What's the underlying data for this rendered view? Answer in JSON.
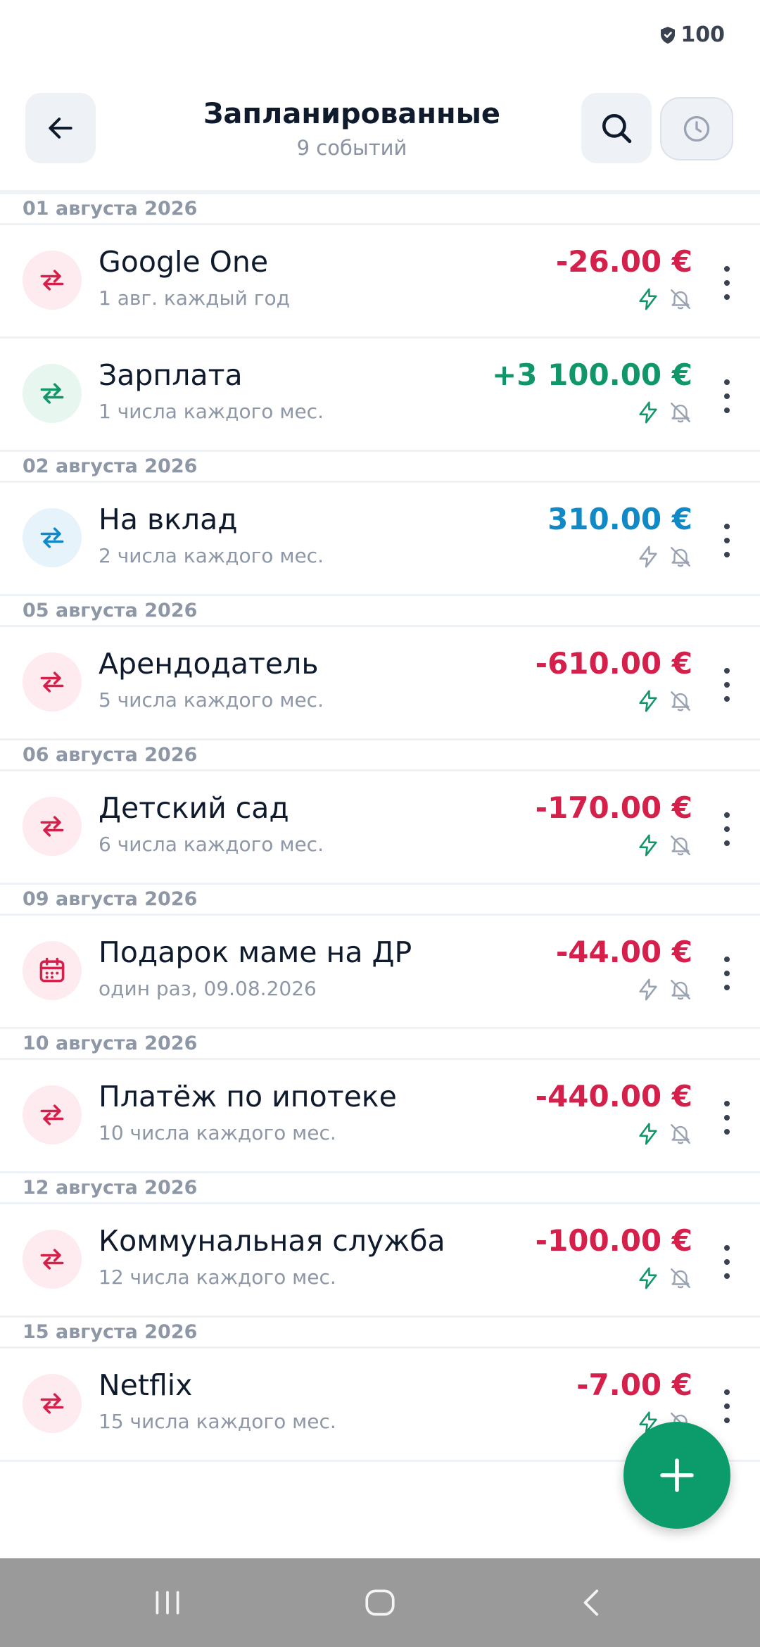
{
  "status": {
    "battery": "100"
  },
  "header": {
    "title": "Запланированные",
    "subtitle": "9 событий"
  },
  "colors": {
    "expense": "#d4204a",
    "income": "#11966a",
    "transfer": "#1189c6",
    "muted": "#8e97a6",
    "fab": "#0c9b6a"
  },
  "groups": [
    {
      "date": "01 августа 2026",
      "items": [
        {
          "name": "Google One",
          "schedule": "1 авг. каждый год",
          "amount": "-26.00 €",
          "type": "expense",
          "icon": "repeat-icon",
          "auto": true
        },
        {
          "name": "Зарплата",
          "schedule": "1 числа каждого мес.",
          "amount": "+3 100.00 €",
          "type": "income",
          "icon": "repeat-icon",
          "auto": true
        }
      ]
    },
    {
      "date": "02 августа 2026",
      "items": [
        {
          "name": "На вклад",
          "schedule": "2 числа каждого мес.",
          "amount": "310.00 €",
          "type": "transfer",
          "icon": "repeat-icon",
          "auto": false
        }
      ]
    },
    {
      "date": "05 августа 2026",
      "items": [
        {
          "name": "Арендодатель",
          "schedule": "5 числа каждого мес.",
          "amount": "-610.00 €",
          "type": "expense",
          "icon": "repeat-icon",
          "auto": true
        }
      ]
    },
    {
      "date": "06 августа 2026",
      "items": [
        {
          "name": "Детский сад",
          "schedule": "6 числа каждого мес.",
          "amount": "-170.00 €",
          "type": "expense",
          "icon": "repeat-icon",
          "auto": true
        }
      ]
    },
    {
      "date": "09 августа 2026",
      "items": [
        {
          "name": "Подарок маме на ДР",
          "schedule": "один раз, 09.08.2026",
          "amount": "-44.00 €",
          "type": "expense",
          "icon": "calendar-icon",
          "auto": false
        }
      ]
    },
    {
      "date": "10 августа 2026",
      "items": [
        {
          "name": "Платёж по ипотеке",
          "schedule": "10 числа каждого мес.",
          "amount": "-440.00 €",
          "type": "expense",
          "icon": "repeat-icon",
          "auto": true
        }
      ]
    },
    {
      "date": "12 августа 2026",
      "items": [
        {
          "name": "Коммунальная служба",
          "schedule": "12 числа каждого мес.",
          "amount": "-100.00 €",
          "type": "expense",
          "icon": "repeat-icon",
          "auto": true
        }
      ]
    },
    {
      "date": "15 августа 2026",
      "items": [
        {
          "name": "Netflix",
          "schedule": "15 числа каждого мес.",
          "amount": "-7.00 €",
          "type": "expense",
          "icon": "repeat-icon",
          "auto": true
        }
      ]
    }
  ]
}
